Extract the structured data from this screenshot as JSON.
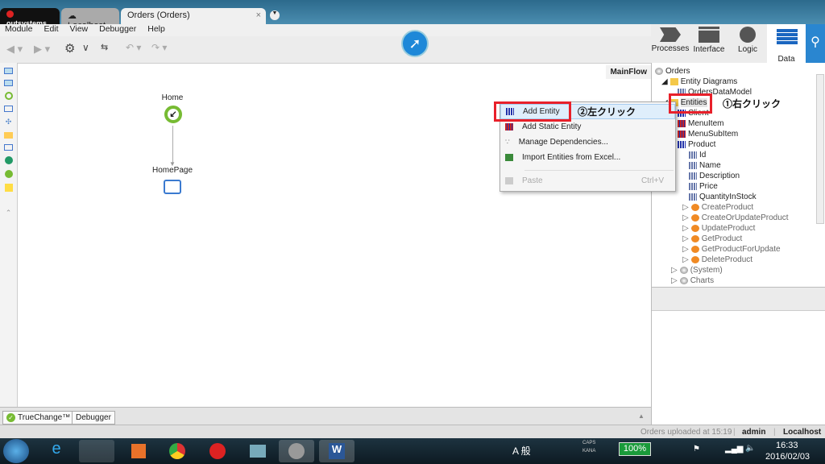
{
  "tabs": {
    "brand": "outsystems",
    "server": "Localhost",
    "active": "Orders (Orders)"
  },
  "menu": [
    "Module",
    "Edit",
    "View",
    "Debugger",
    "Help"
  ],
  "layers": [
    {
      "label": "Processes"
    },
    {
      "label": "Interface"
    },
    {
      "label": "Logic"
    },
    {
      "label": "Data"
    }
  ],
  "canvas": {
    "flow_tab": "MainFlow",
    "nodes": {
      "start": "Home",
      "page": "HomePage"
    }
  },
  "tree": {
    "root": "Orders",
    "diagrams": "Entity Diagrams",
    "diagram": "OrdersDataModel",
    "entities": "Entities",
    "entity_list": [
      "Client",
      "MenuItem",
      "MenuSubItem",
      "Product"
    ],
    "attributes": [
      "Id",
      "Name",
      "Description",
      "Price",
      "QuantityInStock"
    ],
    "actions": [
      "CreateProduct",
      "CreateOrUpdateProduct",
      "UpdateProduct",
      "GetProduct",
      "GetProductForUpdate",
      "DeleteProduct"
    ],
    "modules": [
      "(System)",
      "Charts"
    ]
  },
  "context_menu": {
    "items": [
      "Add Entity",
      "Add Static Entity",
      "Manage Dependencies...",
      "Import Entities from Excel..."
    ],
    "paste": "Paste",
    "paste_shortcut": "Ctrl+V"
  },
  "annotations": {
    "step1": "①右クリック",
    "step2": "②左クリック",
    "color": "#e8202a"
  },
  "bottom_tabs": [
    "TrueChange™",
    "Debugger"
  ],
  "status": {
    "message": "Orders uploaded at 15:19",
    "user": "admin",
    "server": "Localhost"
  },
  "taskbar": {
    "battery": "100%",
    "time": "16:33",
    "date": "2016/02/03",
    "ime": "A 般",
    "caps": "CAPS",
    "kana": "KANA"
  }
}
